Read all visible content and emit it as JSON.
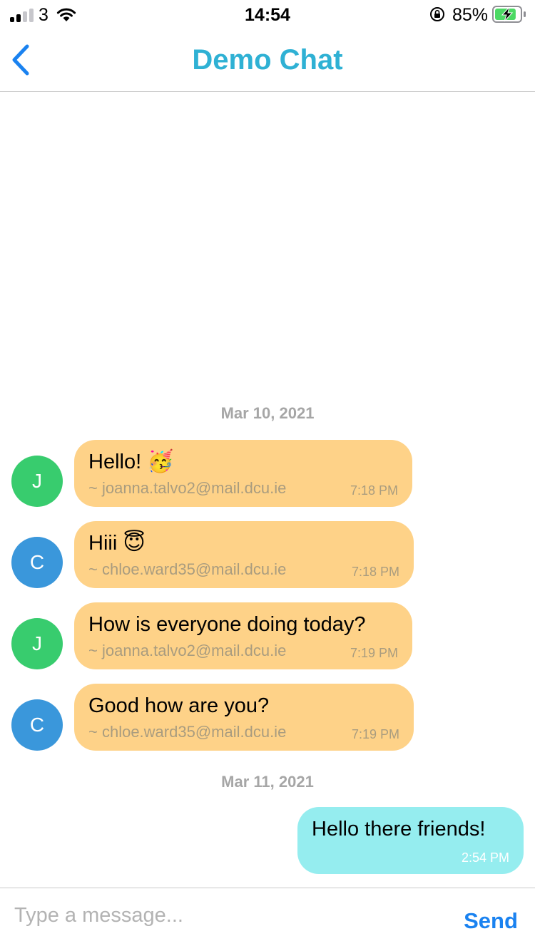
{
  "status_bar": {
    "carrier": "3",
    "time": "14:54",
    "battery_percent": "85%",
    "signal_bars_on": 2,
    "signal_bars_total": 4,
    "battery_level": 0.85,
    "charging": true
  },
  "nav": {
    "back_icon": "chevron-left-icon",
    "title": "Demo Chat"
  },
  "colors": {
    "title": "#2fb1d4",
    "accent": "#1a82f0",
    "incoming_bubble": "#fed288",
    "outgoing_bubble": "#95edef",
    "avatar_green": "#38cc6e",
    "avatar_blue": "#3a97db"
  },
  "dates": [
    "Mar 10, 2021",
    "Mar 11, 2021"
  ],
  "messages": [
    {
      "avatar": "J",
      "text": "Hello!",
      "emoji": "🥳",
      "sender": "~ joanna.talvo2@mail.dcu.ie",
      "time": "7:18 PM"
    },
    {
      "avatar": "C",
      "text": "Hiii",
      "emoji": "😇",
      "sender": "~ chloe.ward35@mail.dcu.ie",
      "time": "7:18 PM"
    },
    {
      "avatar": "J",
      "text": "How is everyone doing today?",
      "emoji": "",
      "sender": "~ joanna.talvo2@mail.dcu.ie",
      "time": "7:19 PM"
    },
    {
      "avatar": "C",
      "text": "Good how are you?",
      "emoji": "",
      "sender": "~ chloe.ward35@mail.dcu.ie",
      "time": "7:19 PM"
    }
  ],
  "outgoing": {
    "text": "Hello there friends!",
    "time": "2:54 PM"
  },
  "composer": {
    "placeholder": "Type a message...",
    "value": "",
    "send_label": "Send"
  }
}
